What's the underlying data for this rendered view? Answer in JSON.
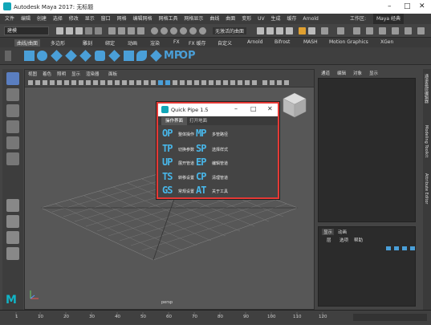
{
  "app": {
    "title": "Autodesk Maya 2017: 无标题"
  },
  "menubar": {
    "items": [
      "文件",
      "编辑",
      "创建",
      "选择",
      "修改",
      "显示",
      "窗口",
      "网格",
      "编辑网格",
      "网格工具",
      "网格显示",
      "曲线",
      "曲面",
      "变形",
      "UV",
      "生成",
      "缓存",
      "Arnold"
    ],
    "workspace_label": "工作区:",
    "workspace_value": "Maya 经典"
  },
  "statusline": {
    "mode": "建模",
    "no_live_surface": "无激活的曲面"
  },
  "shelf_tabs": [
    "曲线/曲面",
    "多边形",
    "雕刻",
    "绑定",
    "动画",
    "渲染",
    "FX",
    "FX 缓存",
    "自定义",
    "Arnold",
    "Bifrost",
    "MASH",
    "Motion Graphics",
    "XGen"
  ],
  "viewport": {
    "menu": [
      "视图",
      "着色",
      "照明",
      "显示",
      "渲染器",
      "面板"
    ],
    "camera_label": "persp"
  },
  "right_panel": {
    "top_menu": [
      "通道",
      "编辑",
      "对象",
      "显示"
    ],
    "layer_tabs": [
      "显示",
      "动画"
    ],
    "layer_menu": [
      "层",
      "选项",
      "帮助"
    ],
    "vertical_tabs": [
      "通道盒/层编辑器",
      "Modeling Toolkit",
      "Attribute Editor"
    ]
  },
  "timeline": {
    "ticks": [
      "1",
      "10",
      "20",
      "30",
      "40",
      "50",
      "60",
      "70",
      "80",
      "90",
      "100",
      "110",
      "120"
    ]
  },
  "dialog": {
    "title": "Quick Pipe 1.5",
    "tabs": [
      "操作界面",
      "打开地面"
    ],
    "items": [
      {
        "code": "OP",
        "label": "整体操作"
      },
      {
        "code": "MP",
        "label": "多管路径"
      },
      {
        "code": "TP",
        "label": "切换参数"
      },
      {
        "code": "SP",
        "label": "选择样式"
      },
      {
        "code": "UP",
        "label": "展开管道"
      },
      {
        "code": "EP",
        "label": "编辑管道"
      },
      {
        "code": "TS",
        "label": "转移设置"
      },
      {
        "code": "CP",
        "label": "清理管道"
      },
      {
        "code": "GS",
        "label": "常规设置"
      },
      {
        "code": "AT",
        "label": "关于工具"
      }
    ]
  },
  "colors": {
    "accent": "#48b6e8",
    "highlight_border": "#e53935",
    "maya_teal": "#11a6b8"
  }
}
